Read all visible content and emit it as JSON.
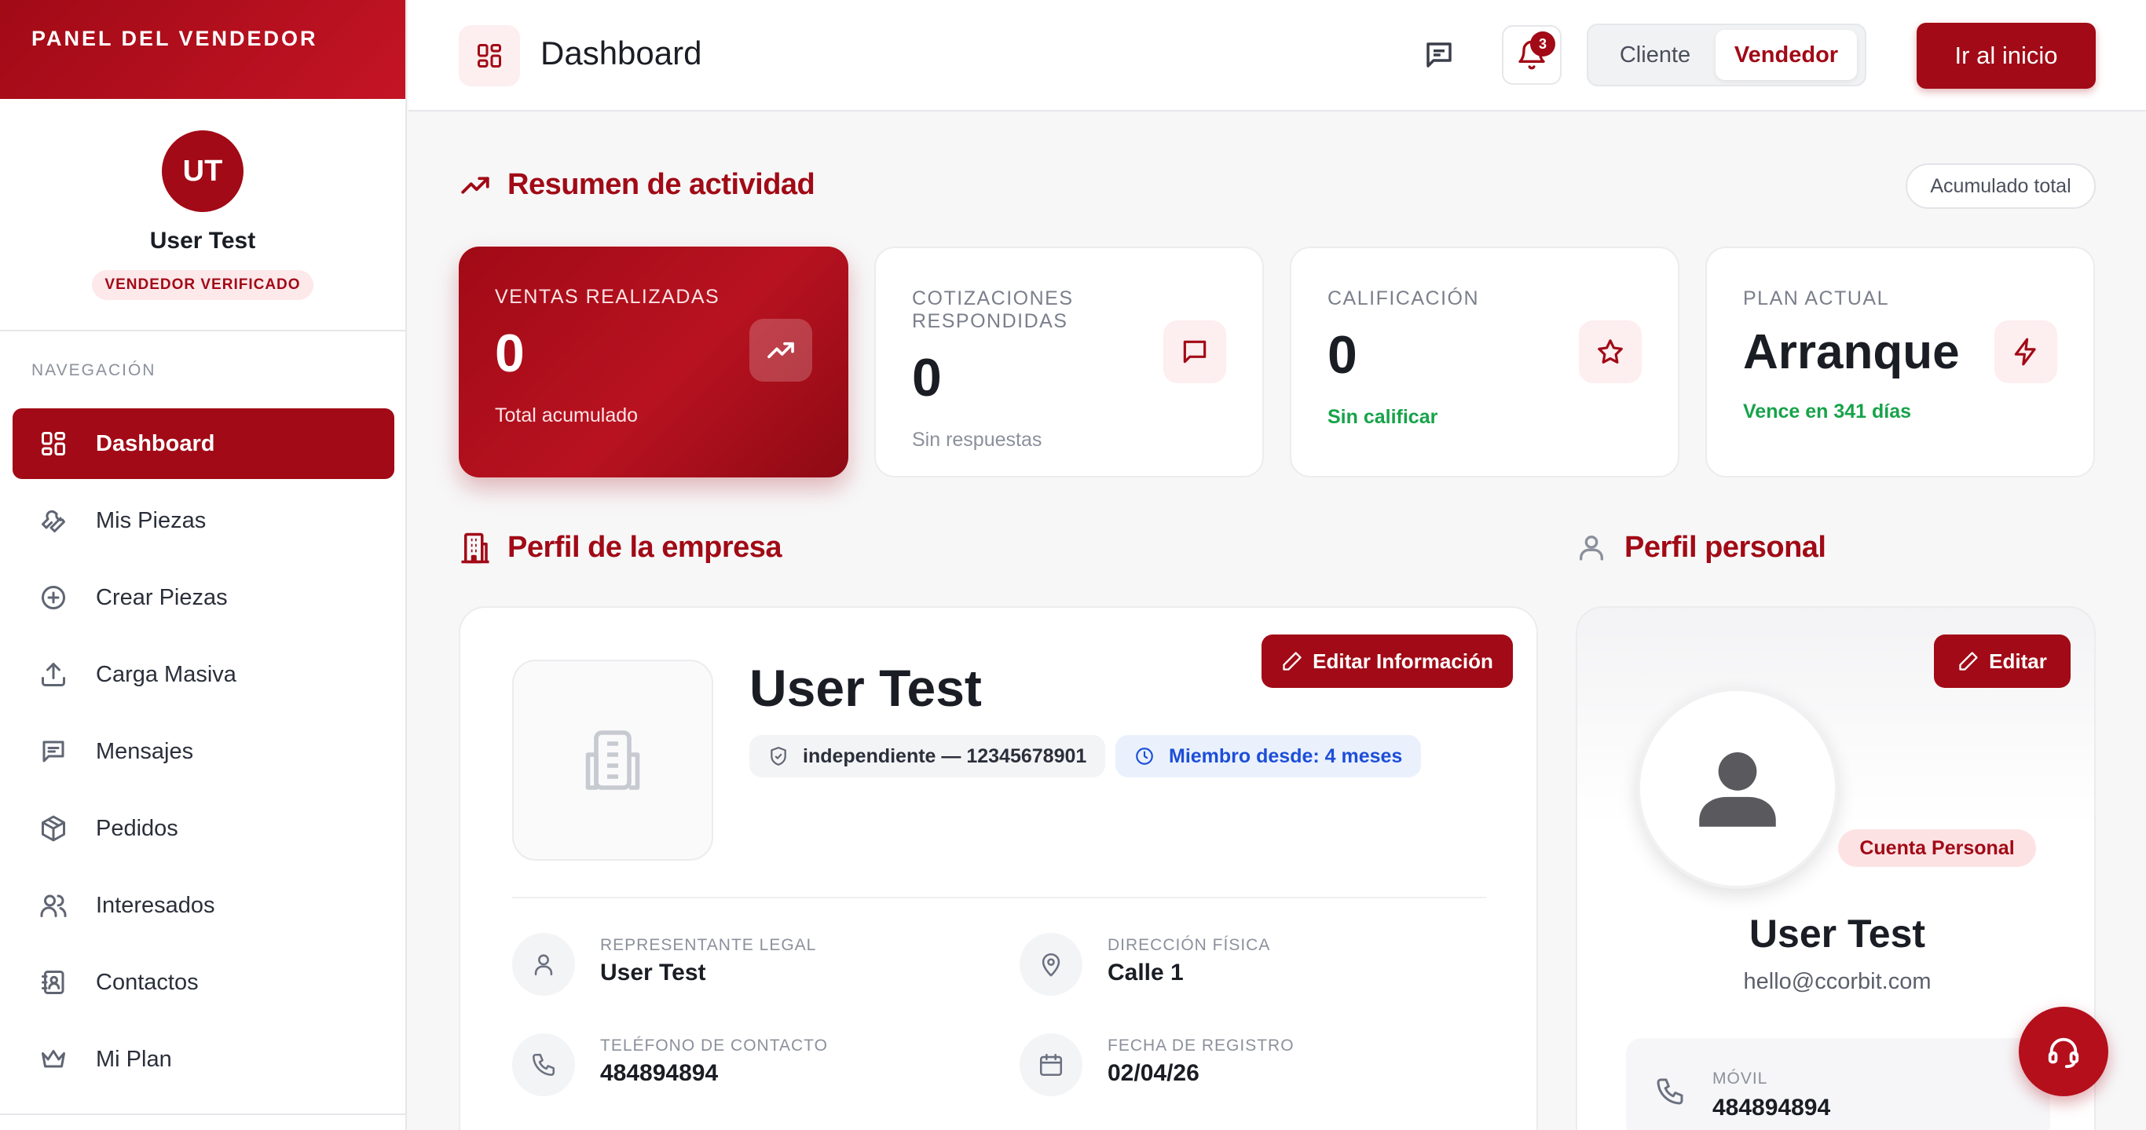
{
  "sidebar": {
    "brand": "PANEL DEL VENDEDOR",
    "avatar_initials": "UT",
    "user_name": "User Test",
    "verified_badge": "VENDEDOR VERIFICADO",
    "nav_label": "NAVEGACIÓN",
    "items": [
      {
        "label": "Dashboard",
        "icon": "dashboard-icon",
        "active": true
      },
      {
        "label": "Mis Piezas",
        "icon": "wrench-icon"
      },
      {
        "label": "Crear Piezas",
        "icon": "plus-circle-icon"
      },
      {
        "label": "Carga Masiva",
        "icon": "upload-icon"
      },
      {
        "label": "Mensajes",
        "icon": "message-icon"
      },
      {
        "label": "Pedidos",
        "icon": "package-icon"
      },
      {
        "label": "Interesados",
        "icon": "users-icon"
      },
      {
        "label": "Contactos",
        "icon": "contact-book-icon"
      },
      {
        "label": "Mi Plan",
        "icon": "crown-icon"
      }
    ]
  },
  "header": {
    "title": "Dashboard",
    "notification_count": "3",
    "toggle": {
      "option_a": "Cliente",
      "option_b": "Vendedor",
      "selected": "Vendedor"
    },
    "home_button": "Ir al inicio"
  },
  "summary": {
    "title": "Resumen de actividad",
    "pill": "Acumulado total",
    "cards": [
      {
        "label": "VENTAS REALIZADAS",
        "value": "0",
        "sub": "Total acumulado",
        "icon": "trending-up-icon"
      },
      {
        "label": "COTIZACIONES RESPONDIDAS",
        "value": "0",
        "sub": "Sin respuestas",
        "icon": "message-icon"
      },
      {
        "label": "CALIFICACIÓN",
        "value": "0",
        "sub": "Sin calificar",
        "icon": "star-icon"
      },
      {
        "label": "PLAN ACTUAL",
        "value": "Arranque",
        "sub": "Vence en 341 días",
        "icon": "lightning-icon"
      }
    ]
  },
  "company": {
    "section_title": "Perfil de la empresa",
    "name": "User Test",
    "edit_button": "Editar Información",
    "id_chip": "independiente — 12345678901",
    "member_chip": "Miembro desde: 4 meses",
    "fields": {
      "legal_rep_label": "REPRESENTANTE LEGAL",
      "legal_rep_value": "User Test",
      "address_label": "DIRECCIÓN FÍSICA",
      "address_value": "Calle 1",
      "phone_label": "TELÉFONO DE CONTACTO",
      "phone_value": "484894894",
      "reg_label": "FECHA DE REGISTRO",
      "reg_value": "02/04/26"
    }
  },
  "personal": {
    "section_title": "Perfil personal",
    "edit_button": "Editar",
    "badge": "Cuenta Personal",
    "name": "User Test",
    "email": "hello@ccorbit.com",
    "mobile_label": "MÓVIL",
    "mobile_value": "484894894"
  },
  "colors": {
    "brand": "#a10a16",
    "success": "#17a34a",
    "info": "#1d4ed8"
  }
}
